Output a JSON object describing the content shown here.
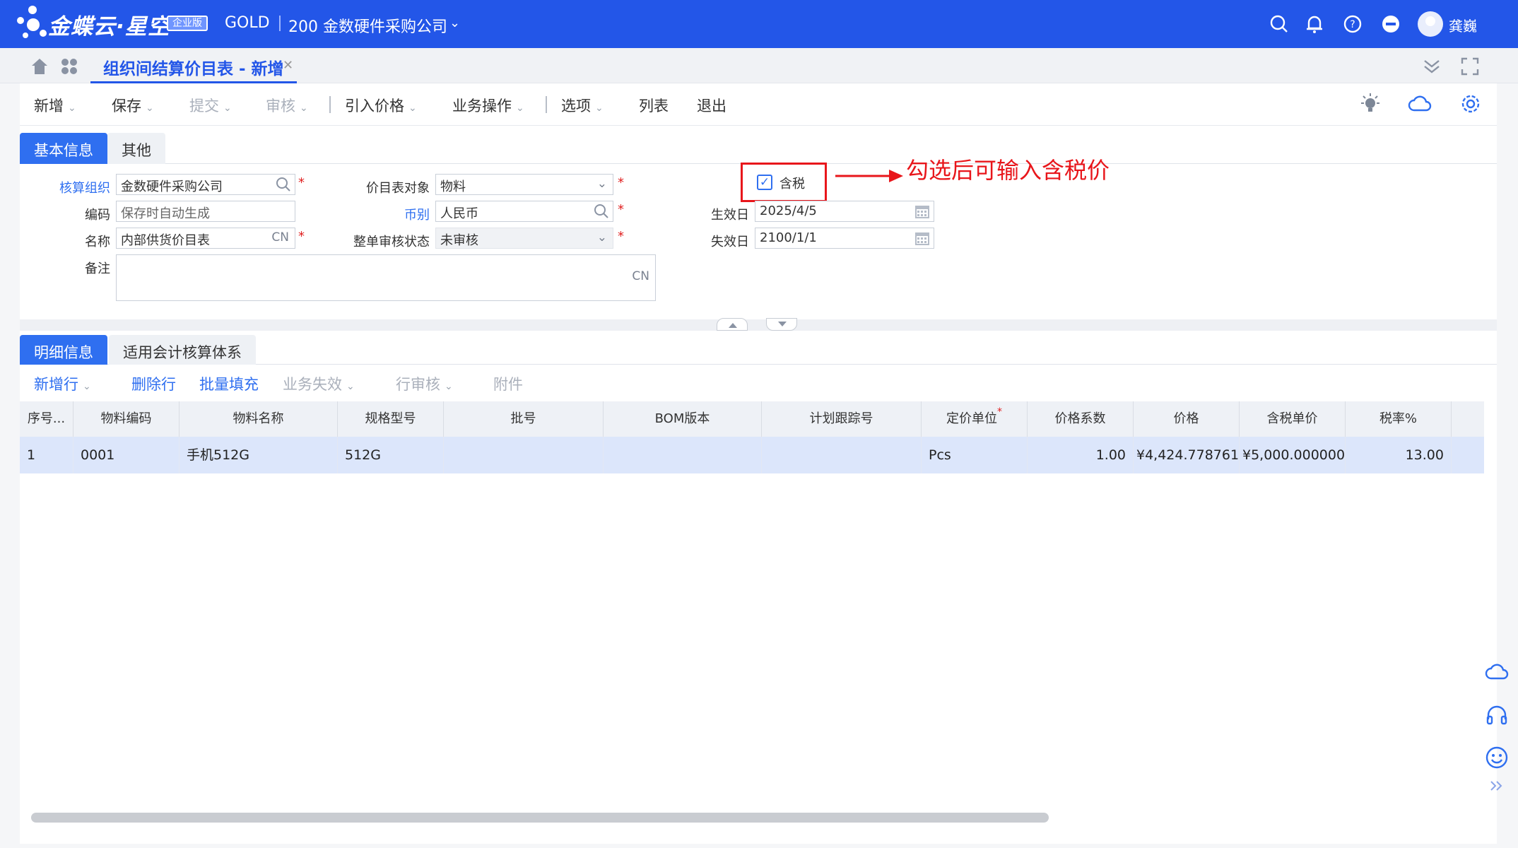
{
  "topbar": {
    "brand": "金蝶云·星空",
    "edition": "企业版",
    "dc": "GOLD",
    "company": "200 金数硬件采购公司",
    "username": "龚巍"
  },
  "page_tab": {
    "title": "组织间结算价目表 - 新增"
  },
  "toolbar": {
    "items": [
      {
        "label": "新增",
        "enabled": true
      },
      {
        "label": "保存",
        "enabled": true
      },
      {
        "label": "提交",
        "enabled": false
      },
      {
        "label": "审核",
        "enabled": false
      },
      {
        "label": "引入价格",
        "enabled": true
      },
      {
        "label": "业务操作",
        "enabled": true
      },
      {
        "label": "选项",
        "enabled": true
      },
      {
        "label": "列表",
        "enabled": true
      },
      {
        "label": "退出",
        "enabled": true
      }
    ]
  },
  "form": {
    "tabs": [
      "基本信息",
      "其他"
    ],
    "org_label": "核算组织",
    "org_value": "金数硬件采购公司",
    "code_label": "编码",
    "code_placeholder": "保存时自动生成",
    "name_label": "名称",
    "name_value": "内部供货价目表",
    "name_suffix": "CN",
    "remark_label": "备注",
    "remark_suffix": "CN",
    "target_label": "价目表对象",
    "target_value": "物料",
    "currency_label": "币别",
    "currency_value": "人民币",
    "audit_label": "整单审核状态",
    "audit_value": "未审核",
    "tax_label": "含税",
    "tax_checked": true,
    "effective_label": "生效日",
    "effective_value": "2025/4/5",
    "expire_label": "失效日",
    "expire_value": "2100/1/1"
  },
  "annotation": "勾选后可输入含税价",
  "detail": {
    "tabs": [
      "明细信息",
      "适用会计核算体系"
    ],
    "tools": [
      {
        "label": "新增行",
        "enabled": true,
        "dropdown": true
      },
      {
        "label": "删除行",
        "enabled": true,
        "dropdown": false
      },
      {
        "label": "批量填充",
        "enabled": true,
        "dropdown": false
      },
      {
        "label": "业务失效",
        "enabled": false,
        "dropdown": true
      },
      {
        "label": "行审核",
        "enabled": false,
        "dropdown": true
      },
      {
        "label": "附件",
        "enabled": false,
        "dropdown": false
      }
    ],
    "columns": [
      "序号...",
      "物料编码",
      "物料名称",
      "规格型号",
      "批号",
      "BOM版本",
      "计划跟踪号",
      "定价单位",
      "价格系数",
      "价格",
      "含税单价",
      "税率%"
    ],
    "rows": [
      {
        "seq": "1",
        "code": "0001",
        "name": "手机512G",
        "spec": "512G",
        "lot": "",
        "bom": "",
        "track": "",
        "unit": "Pcs",
        "coef": "1.00",
        "price": "¥4,424.778761",
        "tax_price": "¥5,000.000000",
        "tax_rate": "13.00"
      }
    ]
  },
  "colors": {
    "brand": "#2356e8",
    "accent": "#2f6ff0",
    "annotation": "#e8161b"
  },
  "icons": [
    "search-icon",
    "bell-icon",
    "help-icon",
    "minus-circle-icon",
    "home-icon",
    "apps-icon",
    "collapse-icon",
    "fullscreen-icon",
    "lightbulb-icon",
    "cloud-icon",
    "gear-icon",
    "calendar-icon",
    "headset-icon",
    "smile-icon"
  ]
}
